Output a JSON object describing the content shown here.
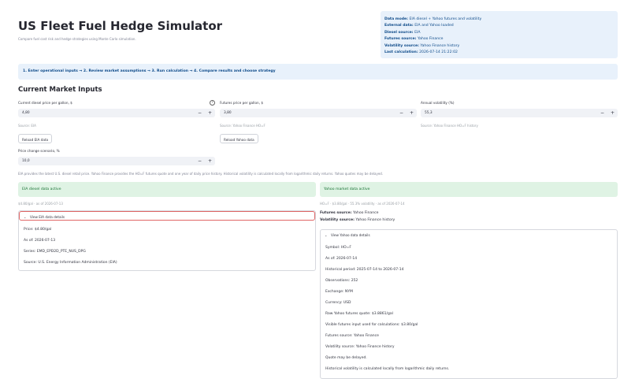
{
  "header": {
    "title": "US Fleet Fuel Hedge Simulator",
    "subtitle": "Compare fuel cost risk and hedge strategies using Monte Carlo simulation."
  },
  "status": {
    "data_mode_label": "Data mode:",
    "data_mode": "EIA diesel + Yahoo futures and volatility",
    "external_label": "External data:",
    "external": "EIA and Yahoo loaded",
    "diesel_label": "Diesel source:",
    "diesel": "EIA",
    "futures_label": "Futures source:",
    "futures": "Yahoo Finance",
    "volatility_label": "Volatility source:",
    "volatility": "Yahoo Finance history",
    "last_calc_label": "Last calculation:",
    "last_calc": "2026-07-14 21:22:02"
  },
  "steps": "1. Enter operational inputs → 2. Review market assumptions → 3. Run calculation → 4. Compare results and choose strategy",
  "section_title": "Current Market Inputs",
  "inputs": {
    "diesel": {
      "label": "Current diesel price per gallon, $",
      "value": "4,80",
      "source": "Source: EIA"
    },
    "futures": {
      "label": "Futures price per gallon, $",
      "value": "3,80",
      "source": "Source: Yahoo Finance HO=F"
    },
    "volatility": {
      "label": "Annual volatility (%)",
      "value": "55,3",
      "source": "Source: Yahoo Finance HO=F history"
    },
    "price_change": {
      "label": "Price change scenario, %",
      "value": "10,0"
    }
  },
  "buttons": {
    "reload_eia": "Reload EIA data",
    "reload_yahoo": "Reload Yahoo data"
  },
  "note": "EIA provides the latest U.S. diesel retail price. Yahoo Finance provides the HO=F futures quote and one year of daily price history. Historical volatility is calculated locally from logarithmic daily returns. Yahoo quotes may be delayed.",
  "eia_panel": {
    "banner": "EIA diesel data active",
    "caption": "$4.80/gal · as of 2026-07-13",
    "expander_label": "View EIA data details",
    "lines": [
      "Price: $4.80/gal",
      "As of: 2026-07-13",
      "Series: EMD_EPD2D_PTE_NUS_DPG",
      "Source: U.S. Energy Information Administration (EIA)"
    ]
  },
  "yahoo_panel": {
    "banner": "Yahoo market data active",
    "caption": "HO=F · $3.80/gal · 55.3% volatility · as of 2026-07-14",
    "futures_label": "Futures source:",
    "futures_value": "Yahoo Finance",
    "volatility_label": "Volatility source:",
    "volatility_value": "Yahoo Finance history",
    "expander_label": "View Yahoo data details",
    "lines": [
      "Symbol: HO=F",
      "As of: 2026-07-14",
      "Historical period: 2025-07-14 to 2026-07-14",
      "Observations: 252",
      "Exchange: NYM",
      "Currency: USD",
      "Raw Yahoo futures quote: $3.8861/gal",
      "Visible futures input used for calculations: $3.80/gal",
      "Futures source: Yahoo Finance",
      "Volatility source: Yahoo Finance history",
      "Quote may be delayed.",
      "Historical volatility is calculated locally from logarithmic daily returns."
    ]
  },
  "icons": {
    "help": "help-circle-icon",
    "chevron": "chevron-down-icon",
    "minus": "minus-icon",
    "plus": "plus-icon"
  },
  "colors": {
    "info_bg": "#e8f1fb",
    "info_text": "#0e4b8a",
    "success_bg": "#dff3e4",
    "success_text": "#177233",
    "focus_border": "#e06666"
  }
}
